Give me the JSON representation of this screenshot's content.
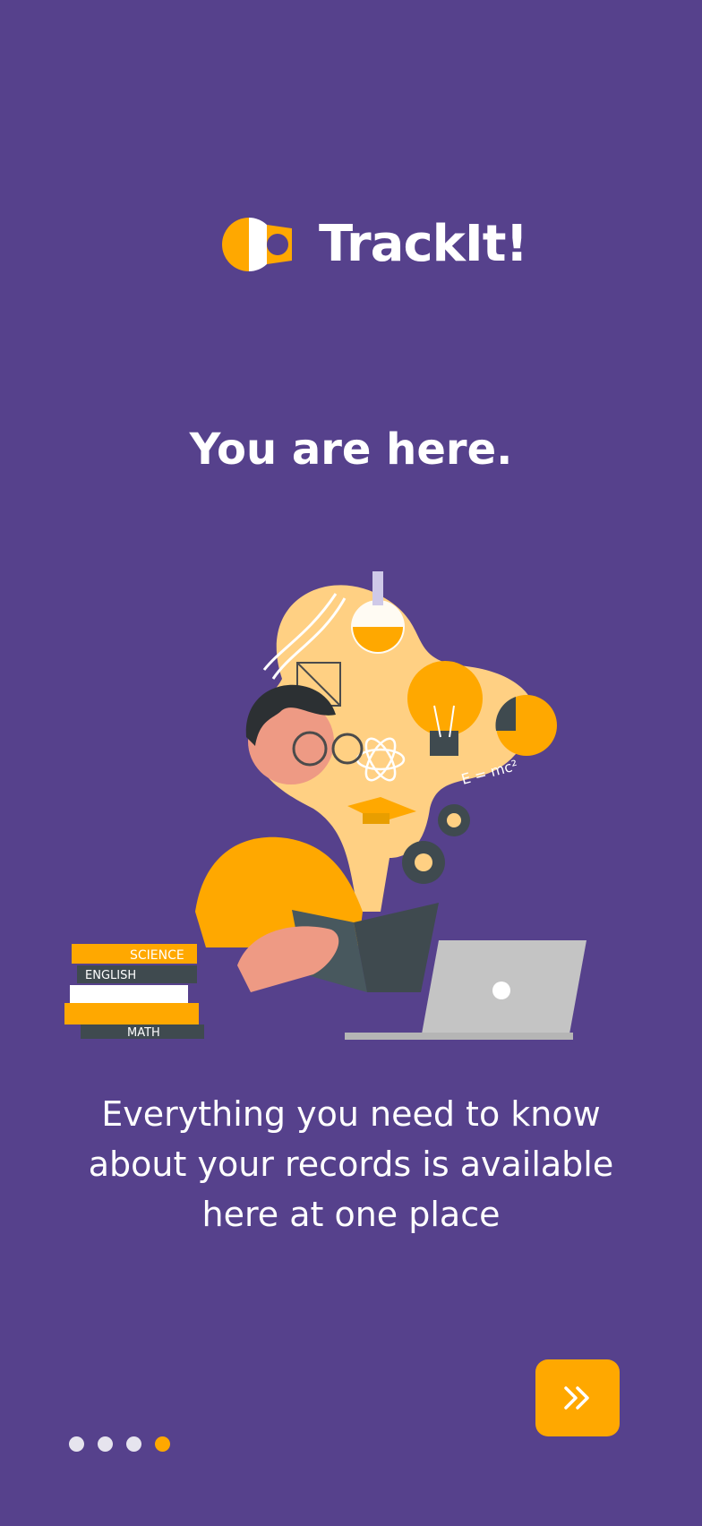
{
  "brand": {
    "name": "TrackIt!",
    "logo_icon": "trackit-logo-icon"
  },
  "headline": "You are here.",
  "illustration": {
    "icon": "student-studying-illustration",
    "books": {
      "science": "SCIENCE",
      "english": "ENGLISH",
      "math": "MATH"
    },
    "formula": "E = mc²"
  },
  "description": "Everything you need to know about your records is available here at one place",
  "pagination": {
    "total": 4,
    "active_index": 3
  },
  "next_button": {
    "icon": "double-chevron-right-icon"
  },
  "colors": {
    "background": "#56418c",
    "accent": "#ffa800",
    "text": "#ffffff",
    "dot_inactive": "#e6e4ee"
  }
}
